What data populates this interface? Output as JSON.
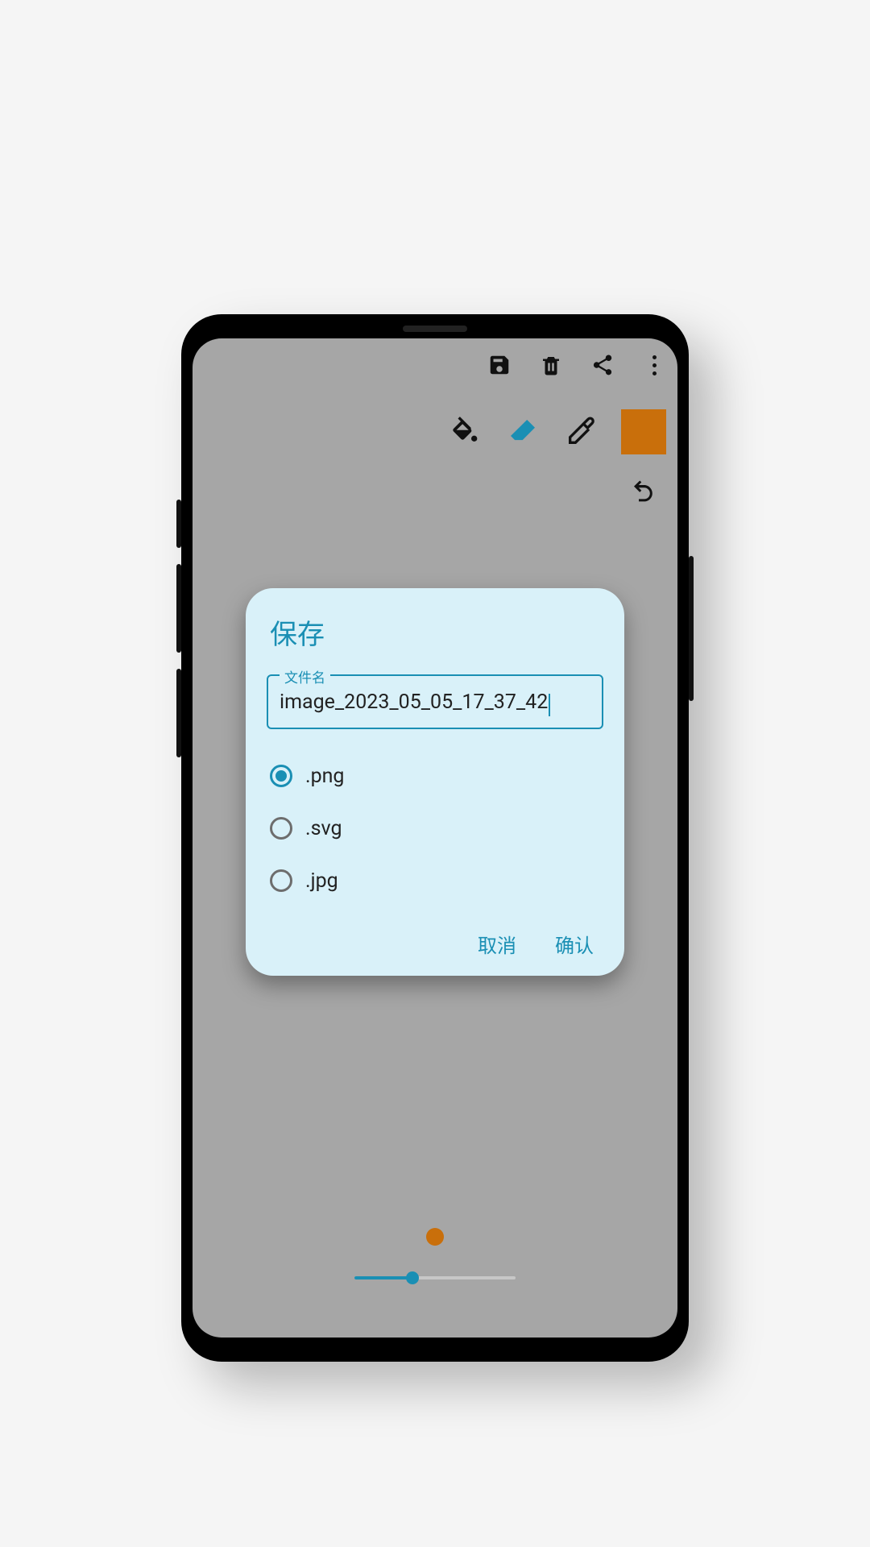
{
  "toolbar": {
    "save_icon": "save",
    "delete_icon": "delete",
    "share_icon": "share",
    "more_icon": "more"
  },
  "tools": {
    "fill_icon": "paint-bucket",
    "eraser_icon": "eraser",
    "picker_icon": "eyedropper",
    "swatch_color": "#c96f0b",
    "undo_icon": "undo"
  },
  "dialog": {
    "title": "保存",
    "filename_label": "文件名",
    "filename_value": "image_2023_05_05_17_37_42",
    "formats": [
      {
        "label": ".png",
        "selected": true
      },
      {
        "label": ".svg",
        "selected": false
      },
      {
        "label": ".jpg",
        "selected": false
      }
    ],
    "cancel_label": "取消",
    "confirm_label": "确认"
  },
  "brush": {
    "preview_color": "#c96f0b",
    "slider_percent": 36
  }
}
